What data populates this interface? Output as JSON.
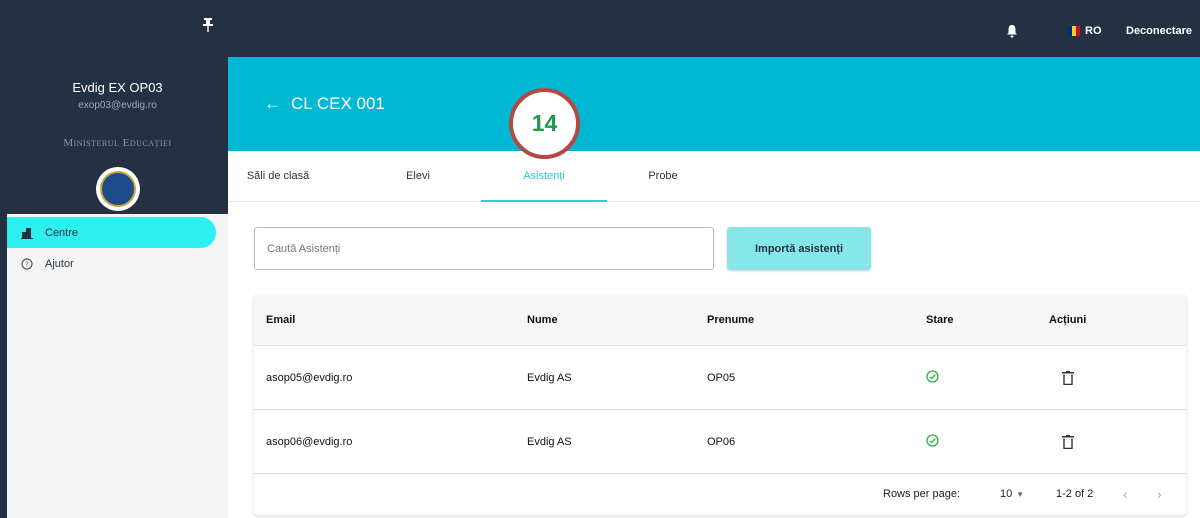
{
  "sidebar": {
    "user_name": "Evdig EX OP03",
    "user_email": "exop03@evdig.ro",
    "ministry": "Ministerul Educației",
    "logo_text": "Guvernul României",
    "items": [
      {
        "label": "Centre",
        "icon": "building-icon",
        "active": true
      },
      {
        "label": "Ajutor",
        "icon": "help-circle-icon",
        "active": false
      }
    ]
  },
  "topbar": {
    "language": "RO",
    "logout_label": "Deconectare",
    "flag_colors": [
      "#002B7F",
      "#FCD116",
      "#CE1126"
    ]
  },
  "header": {
    "title": "CL CEX 001",
    "back_icon": "arrow-left-icon"
  },
  "step_badge": "14",
  "tabs": [
    {
      "label": "Săli de clasă",
      "active": false
    },
    {
      "label": "Elevi",
      "active": false
    },
    {
      "label": "Asistenți",
      "active": true
    },
    {
      "label": "Probe",
      "active": false
    }
  ],
  "search": {
    "placeholder": "Caută Asistenți",
    "value": ""
  },
  "import_label": "Importă asistenți",
  "table": {
    "columns": [
      "Email",
      "Nume",
      "Prenume",
      "Stare",
      "Acțiuni"
    ],
    "rows": [
      {
        "email": "asop05@evdig.ro",
        "nume": "Evdig AS",
        "prenume": "OP05",
        "stare": "check-circle-icon",
        "actiuni": "trash-icon"
      },
      {
        "email": "asop06@evdig.ro",
        "nume": "Evdig AS",
        "prenume": "OP06",
        "stare": "check-circle-icon",
        "actiuni": "trash-icon"
      }
    ],
    "rows_per_page_label": "Rows per page:",
    "rows_per_page": "10",
    "range": "1-2 of 2"
  },
  "colors": {
    "navy": "#233142",
    "banner": "#00B8D4",
    "accent": "#2DCBD3",
    "active_nav": "#2CF0F0",
    "button": "#86E6E8",
    "success": "#2DB04A",
    "badge_ring": "#B34A42",
    "badge_text": "#1F9A48"
  }
}
